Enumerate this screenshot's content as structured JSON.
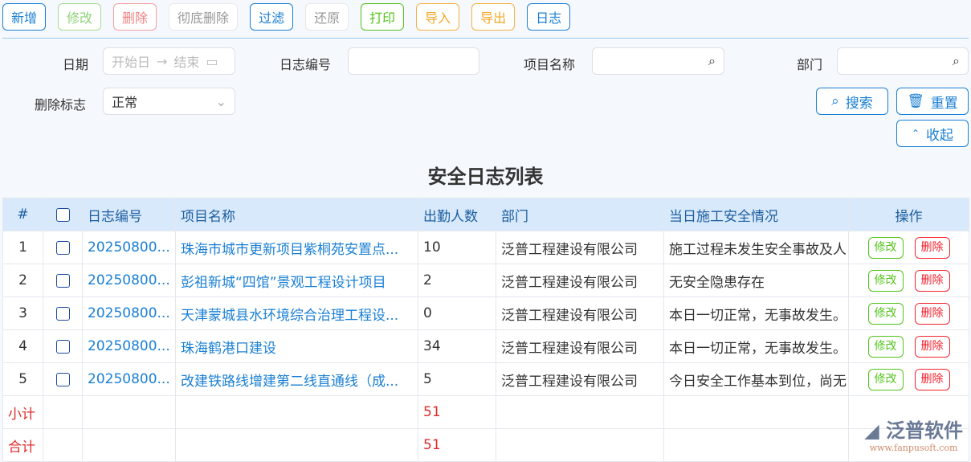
{
  "toolbar": [
    {
      "label": "新增",
      "color": "#1a7fd4",
      "text": "#1a7fd4"
    },
    {
      "label": "修改",
      "color": "#a8dc90",
      "text": "#8fd27a"
    },
    {
      "label": "删除",
      "color": "#f4a0a0",
      "text": "#f08080"
    },
    {
      "label": "彻底删除",
      "color": "#e8e8e8",
      "text": "#999"
    },
    {
      "label": "过滤",
      "color": "#1a7fd4",
      "text": "#1a7fd4"
    },
    {
      "label": "还原",
      "color": "#e8e8e8",
      "text": "#999"
    },
    {
      "label": "打印",
      "color": "#52c41a",
      "text": "#52c41a"
    },
    {
      "label": "导入",
      "color": "#f5b041",
      "text": "#f5a623"
    },
    {
      "label": "导出",
      "color": "#f5b041",
      "text": "#f5a623"
    },
    {
      "label": "日志",
      "color": "#1a7fd4",
      "text": "#1a7fd4"
    }
  ],
  "filters": {
    "date_label": "日期",
    "date_start": "开始日",
    "date_end": "结束",
    "log_no_label": "日志编号",
    "project_label": "项目名称",
    "dept_label": "部门",
    "deleted_label": "删除标志",
    "deleted_value": "正常",
    "search": "搜索",
    "reset": "重置",
    "collapse": "收起"
  },
  "title": "安全日志列表",
  "table": {
    "headers": [
      "#",
      "",
      "日志编号",
      "项目名称",
      "出勤人数",
      "部门",
      "当日施工安全情况",
      "操作"
    ],
    "rows": [
      [
        "1",
        "20250800...",
        "珠海市城市更新项目紫桐苑安置点...",
        "10",
        "泛普工程建设有限公司",
        "施工过程未发生安全事故及人"
      ],
      [
        "2",
        "20250800...",
        "彭祖新城“四馆”景观工程设计项目",
        "2",
        "泛普工程建设有限公司",
        "无安全隐患存在"
      ],
      [
        "3",
        "20250800...",
        "天津蒙城县水环境综合治理工程设...",
        "0",
        "泛普工程建设有限公司",
        "本日一切正常，无事故发生。"
      ],
      [
        "4",
        "20250800...",
        "珠海鹤港口建设",
        "34",
        "泛普工程建设有限公司",
        "本日一切正常，无事故发生。"
      ],
      [
        "5",
        "20250800...",
        "改建铁路线增建第二线直通线（成...",
        "5",
        "泛普工程建设有限公司",
        "今日安全工作基本到位，尚无"
      ]
    ],
    "edit": "修改",
    "delete": "删除",
    "subtotal_label": "小计",
    "subtotal": "51",
    "total_label": "合计",
    "total": "51"
  },
  "logo": {
    "name": "泛普软件",
    "url": "www.fanpusoft.com"
  }
}
